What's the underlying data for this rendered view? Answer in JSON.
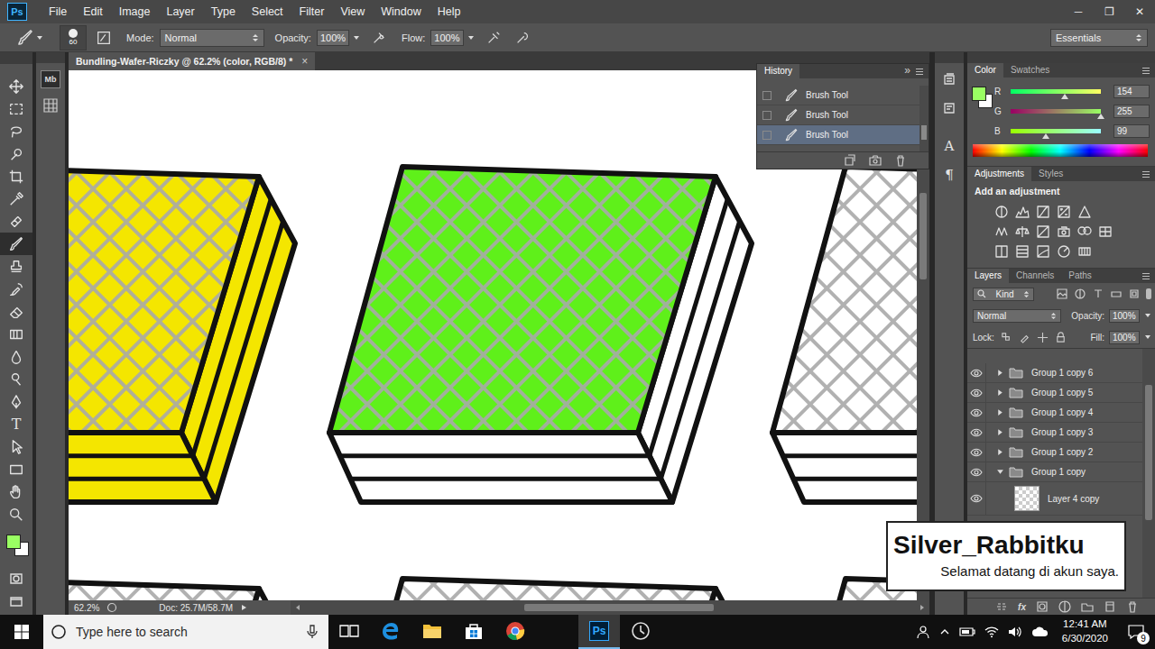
{
  "app": {
    "logo": "Ps",
    "menu": [
      "File",
      "Edit",
      "Image",
      "Layer",
      "Type",
      "Select",
      "Filter",
      "View",
      "Window",
      "Help"
    ],
    "window_controls": [
      "─",
      "❐",
      "✕"
    ]
  },
  "options_bar": {
    "brush_size": "60",
    "mode_label": "Mode:",
    "mode": "Normal",
    "opacity_label": "Opacity:",
    "opacity": "100%",
    "flow_label": "Flow:",
    "flow": "100%",
    "workspace": "Essentials"
  },
  "tools": [
    {
      "kind": "move",
      "selected": false
    },
    {
      "kind": "marquee",
      "selected": false
    },
    {
      "kind": "lasso",
      "selected": false
    },
    {
      "kind": "quick-select",
      "selected": false
    },
    {
      "kind": "crop",
      "selected": false
    },
    {
      "kind": "eyedropper",
      "selected": false
    },
    {
      "kind": "healing",
      "selected": false
    },
    {
      "kind": "brush",
      "selected": true
    },
    {
      "kind": "stamp",
      "selected": false
    },
    {
      "kind": "history-brush",
      "selected": false
    },
    {
      "kind": "eraser",
      "selected": false
    },
    {
      "kind": "gradient",
      "selected": false
    },
    {
      "kind": "blur",
      "selected": false
    },
    {
      "kind": "dodge",
      "selected": false
    },
    {
      "kind": "pen",
      "selected": false
    },
    {
      "kind": "type",
      "glyph": "T",
      "selected": false
    },
    {
      "kind": "path-select",
      "selected": false
    },
    {
      "kind": "shape",
      "selected": false
    },
    {
      "kind": "hand",
      "selected": false
    },
    {
      "kind": "zoom",
      "selected": false
    }
  ],
  "mini_panel": {
    "bridge_label": "Mb"
  },
  "document": {
    "tab_title": "Bundling-Wafer-Riczky @ 62.2% (color, RGB/8) *",
    "close": "×",
    "zoom": "62.2%",
    "doc_info": "Doc: 25.7M/58.7M"
  },
  "canvas": {
    "wafer_rows": [
      {
        "wafers": [
          {
            "top_color": "#f4e600",
            "side_color": "#f4e600"
          },
          {
            "top_color": "#5ff01a",
            "side_color": "#ffffff"
          },
          {
            "top_color": "#ffffff",
            "side_color": "#ffffff"
          }
        ]
      },
      {
        "wafers": [
          {
            "top_color": "#ffffff",
            "side_color": "#ffffff"
          },
          {
            "top_color": "#ffffff",
            "side_color": "#ffffff"
          },
          {
            "top_color": "#ffffff",
            "side_color": "#ffffff"
          }
        ]
      }
    ]
  },
  "history": {
    "title": "History",
    "collapse": "»",
    "items": [
      {
        "label": "Brush Tool",
        "selected": false
      },
      {
        "label": "Brush Tool",
        "selected": false
      },
      {
        "label": "Brush Tool",
        "selected": true
      }
    ]
  },
  "dock_icons": [
    {
      "kind": "history"
    },
    {
      "kind": "properties"
    },
    {
      "kind": "character",
      "glyph": "A"
    },
    {
      "kind": "paragraph",
      "glyph": "¶"
    }
  ],
  "color_panel": {
    "tabs": [
      {
        "label": "Color",
        "selected": true
      },
      {
        "label": "Swatches",
        "selected": false
      }
    ],
    "foreground": "#9aff63",
    "background": "#ffffff",
    "channels": [
      {
        "label": "R",
        "value": "154",
        "level": 0.604
      },
      {
        "label": "G",
        "value": "255",
        "level": 1
      },
      {
        "label": "B",
        "value": "99",
        "level": 0.388
      }
    ]
  },
  "adjustments_panel": {
    "tabs": [
      {
        "label": "Adjustments",
        "selected": true
      },
      {
        "label": "Styles",
        "selected": false
      }
    ],
    "heading": "Add an adjustment",
    "icon_rows": [
      {
        "icons": [
          {
            "kind": "brightness"
          },
          {
            "kind": "levels"
          },
          {
            "kind": "curves"
          },
          {
            "kind": "exposure"
          },
          {
            "kind": "vibrance"
          }
        ]
      },
      {
        "icons": [
          {
            "kind": "hue"
          },
          {
            "kind": "balance"
          },
          {
            "kind": "black-white"
          },
          {
            "kind": "photo-filter"
          },
          {
            "kind": "mixer"
          },
          {
            "kind": "lookup"
          }
        ]
      },
      {
        "icons": [
          {
            "kind": "invert"
          },
          {
            "kind": "posterize"
          },
          {
            "kind": "threshold"
          },
          {
            "kind": "selective"
          },
          {
            "kind": "gradient-map"
          }
        ]
      }
    ]
  },
  "layers_panel": {
    "tabs": [
      {
        "label": "Layers",
        "selected": true
      },
      {
        "label": "Channels",
        "selected": false
      },
      {
        "label": "Paths",
        "selected": false
      }
    ],
    "filter": "Kind",
    "blend_mode": "Normal",
    "opacity_label": "Opacity:",
    "opacity": "100%",
    "lock_label": "Lock:",
    "fill_label": "Fill:",
    "fill": "100%",
    "layers": [
      {
        "kind": "group",
        "name": "Group 1 copy 6",
        "visible": true,
        "expanded": false
      },
      {
        "kind": "group",
        "name": "Group 1 copy 5",
        "visible": true,
        "expanded": false
      },
      {
        "kind": "group",
        "name": "Group 1 copy 4",
        "visible": true,
        "expanded": false
      },
      {
        "kind": "group",
        "name": "Group 1 copy 3",
        "visible": true,
        "expanded": false
      },
      {
        "kind": "group",
        "name": "Group 1 copy 2",
        "visible": true,
        "expanded": false
      },
      {
        "kind": "group",
        "name": "Group 1 copy",
        "visible": true,
        "expanded": true
      },
      {
        "kind": "layer",
        "name": "Layer 4 copy",
        "visible": true
      }
    ],
    "footer_fx": "fx"
  },
  "taskbar": {
    "search_placeholder": "Type here to search",
    "apps": [
      {
        "kind": "task-view",
        "active": false
      },
      {
        "kind": "edge",
        "active": false
      },
      {
        "kind": "explorer",
        "active": false
      },
      {
        "kind": "store",
        "active": false
      },
      {
        "kind": "chrome",
        "active": false
      },
      {
        "kind": "photoshop",
        "glyph": "Ps",
        "active": true
      },
      {
        "kind": "other",
        "active": false
      }
    ],
    "time": "12:41 AM",
    "date": "6/30/2020",
    "notifications": "9"
  },
  "watermark": {
    "title": "Silver_Rabbitku",
    "subtitle": "Selamat datang di akun saya."
  }
}
